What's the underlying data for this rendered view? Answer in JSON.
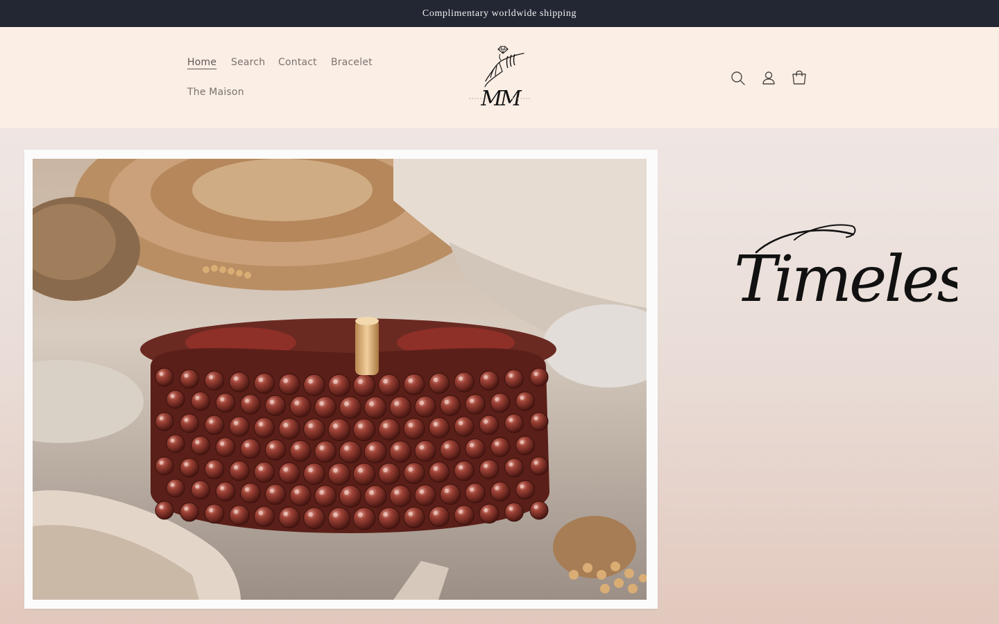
{
  "announcement": {
    "text": "Complimentary worldwide shipping"
  },
  "nav": {
    "items": [
      {
        "label": "Home",
        "active": true
      },
      {
        "label": "Search",
        "active": false
      },
      {
        "label": "Contact",
        "active": false
      },
      {
        "label": "Bracelet",
        "active": false
      },
      {
        "label": "The Maison",
        "active": false
      }
    ]
  },
  "logo": {
    "monogram": "MM"
  },
  "header_icons": [
    "search-icon",
    "account-icon",
    "cart-icon"
  ],
  "hero": {
    "headline": "Timeless"
  },
  "colors": {
    "announcement_bg": "#232733",
    "header_bg": "#faeee5",
    "hero_gradient_top": "#efe6e3",
    "hero_gradient_bottom": "#e2c8bd"
  }
}
